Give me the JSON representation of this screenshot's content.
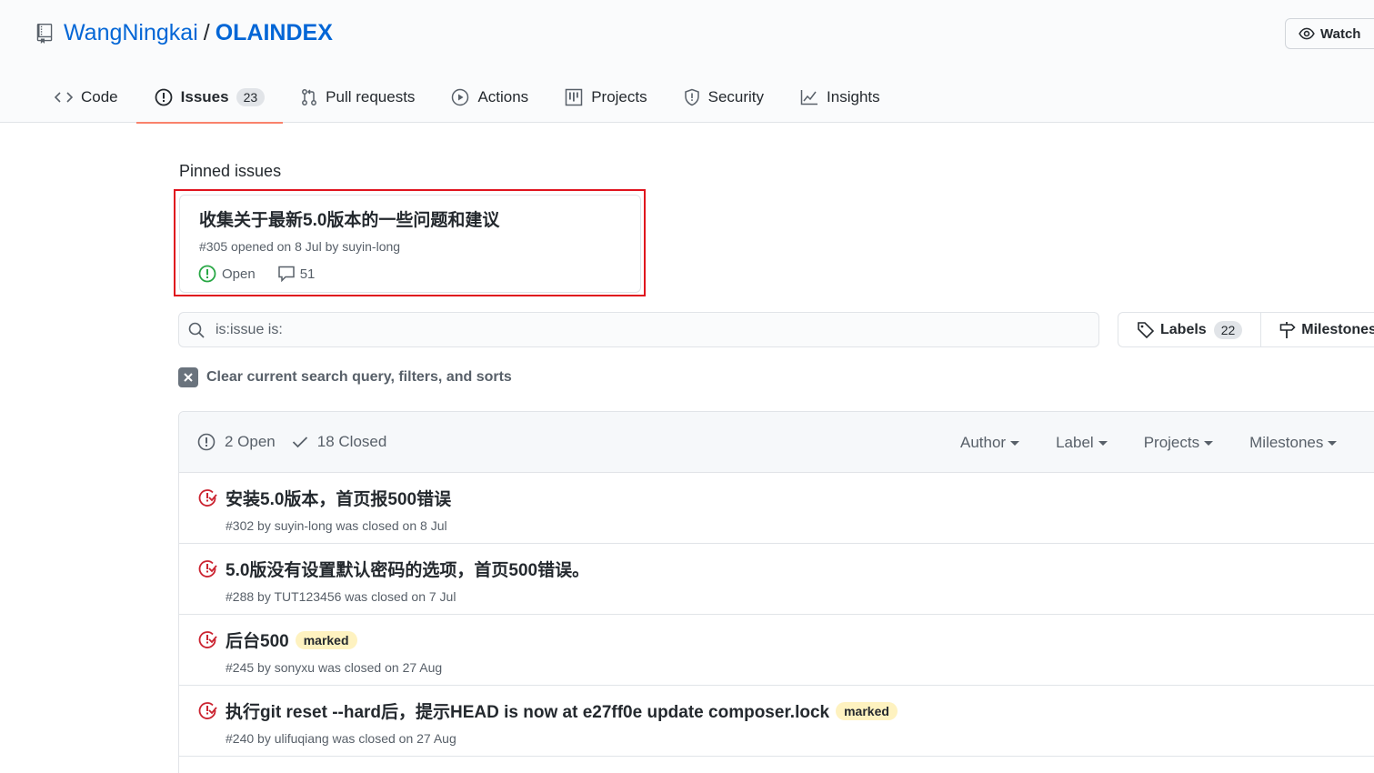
{
  "repo": {
    "owner": "WangNingkai",
    "separator": "/",
    "name": "OLAINDEX",
    "watch_label": "Watch"
  },
  "tabs": [
    {
      "label": "Code",
      "icon": "code-icon"
    },
    {
      "label": "Issues",
      "icon": "issue-opened-icon",
      "count": "23",
      "selected": true
    },
    {
      "label": "Pull requests",
      "icon": "git-pull-request-icon"
    },
    {
      "label": "Actions",
      "icon": "play-icon"
    },
    {
      "label": "Projects",
      "icon": "project-icon"
    },
    {
      "label": "Security",
      "icon": "shield-icon"
    },
    {
      "label": "Insights",
      "icon": "graph-icon"
    }
  ],
  "pinned": {
    "heading": "Pinned issues",
    "title": "收集关于最新5.0版本的一些问题和建议",
    "meta": "#305 opened on 8 Jul by suyin-long",
    "status": "Open",
    "comments": "51"
  },
  "search": {
    "value": "is:issue is:"
  },
  "labels_button": {
    "label": "Labels",
    "count": "22"
  },
  "milestones_button": {
    "label": "Milestones"
  },
  "clear_filter": "Clear current search query, filters, and sorts",
  "issues_header": {
    "open": "2 Open",
    "closed": "18 Closed",
    "filters": [
      "Author",
      "Label",
      "Projects",
      "Milestones"
    ]
  },
  "issues": [
    {
      "title": "安装5.0版本，首页报500错误",
      "meta": "#302 by suyin-long was closed on 8 Jul",
      "label": ""
    },
    {
      "title": "5.0版没有设置默认密码的选项，首页500错误。",
      "meta": "#288 by TUT123456 was closed on 7 Jul",
      "label": ""
    },
    {
      "title": "后台500",
      "meta": "#245 by sonyxu was closed on 27 Aug",
      "label": "marked"
    },
    {
      "title": "执行git reset --hard后，提示HEAD is now at e27ff0e update composer.lock",
      "meta": "#240 by ulifuqiang was closed on 27 Aug",
      "label": "marked"
    }
  ],
  "colors": {
    "link": "#0366d6",
    "tab_underline": "#f9826c",
    "open_green": "#28a745",
    "closed_red": "#cb2431",
    "highlight_box": "#e0141e",
    "marked_label_bg": "#fef2c0"
  }
}
